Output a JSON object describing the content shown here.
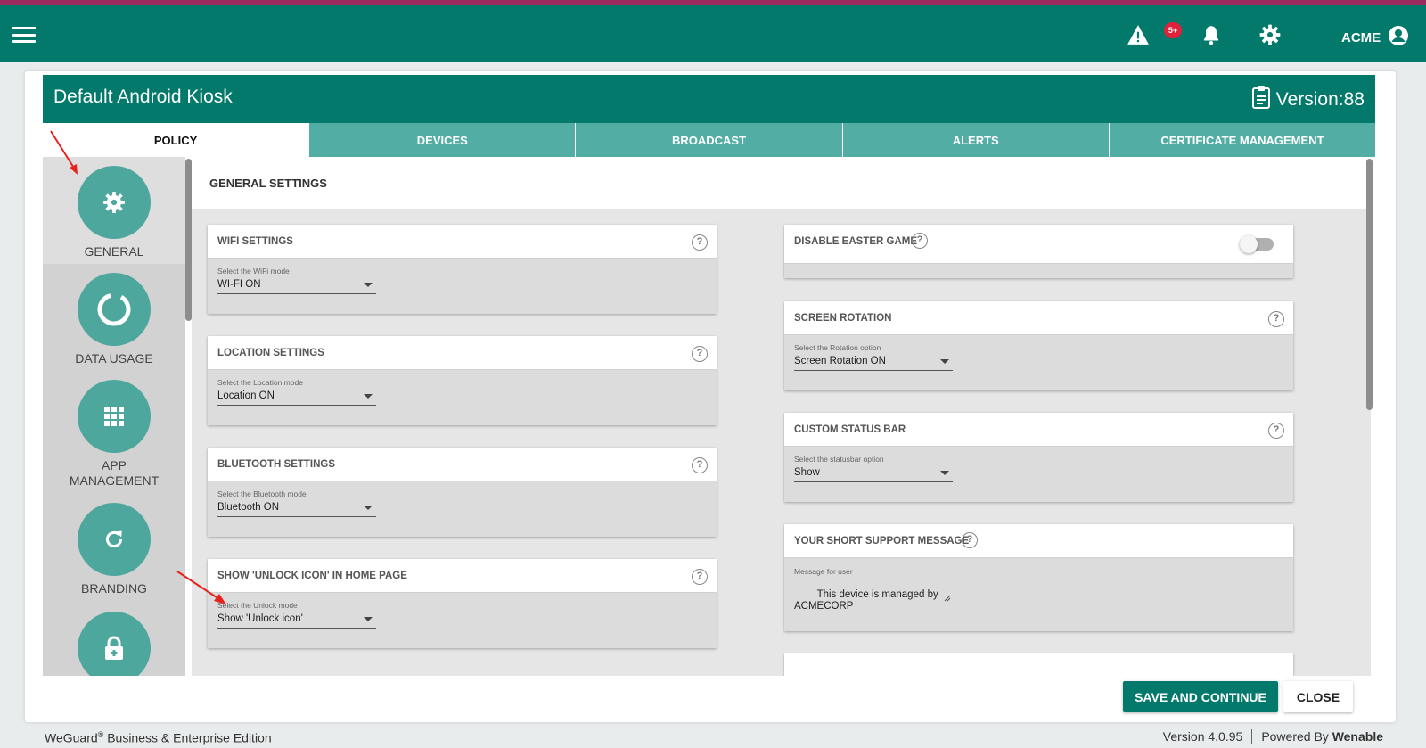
{
  "topbar": {
    "alerts_badge": "5+",
    "user_name": "ACME"
  },
  "policy": {
    "title": "Default Android Kiosk",
    "version": "Version:88"
  },
  "tabs": [
    {
      "label": "POLICY",
      "active": true
    },
    {
      "label": "DEVICES",
      "active": false
    },
    {
      "label": "BROADCAST",
      "active": false
    },
    {
      "label": "ALERTS",
      "active": false
    },
    {
      "label": "CERTIFICATE MANAGEMENT",
      "active": false
    }
  ],
  "nav": [
    {
      "label": "GENERAL",
      "icon": "gear-icon",
      "active": true
    },
    {
      "label": "DATA USAGE",
      "icon": "ring-icon",
      "active": false
    },
    {
      "label": "APP MANAGEMENT",
      "icon": "grid-icon",
      "active": false
    },
    {
      "label": "BRANDING",
      "icon": "refresh-icon",
      "active": false
    },
    {
      "label": "",
      "icon": "lock-icon",
      "active": false
    }
  ],
  "section_title": "GENERAL SETTINGS",
  "left_settings": [
    {
      "title": "WIFI SETTINGS",
      "select_label": "Select the WiFi mode",
      "value": "WI-FI ON"
    },
    {
      "title": "LOCATION SETTINGS",
      "select_label": "Select the Location mode",
      "value": "Location ON"
    },
    {
      "title": "BLUETOOTH SETTINGS",
      "select_label": "Select the Bluetooth mode",
      "value": "Bluetooth ON"
    },
    {
      "title": "SHOW 'UNLOCK ICON' IN HOME PAGE",
      "select_label": "Select the Unlock mode",
      "value": "Show 'Unlock icon'"
    }
  ],
  "right_settings": {
    "easter": {
      "title": "DISABLE EASTER GAME",
      "enabled": false
    },
    "rotation": {
      "title": "SCREEN ROTATION",
      "select_label": "Select the Rotation option",
      "value": "Screen Rotation ON"
    },
    "statusbar": {
      "title": "CUSTOM STATUS BAR",
      "select_label": "Select the statusbar option",
      "value": "Show"
    },
    "support": {
      "title": "YOUR SHORT SUPPORT MESSAGE",
      "field_label": "Message for user",
      "value": "This device is managed by\nACMECORP"
    }
  },
  "buttons": {
    "save": "SAVE AND CONTINUE",
    "close": "CLOSE"
  },
  "footer": {
    "brand": "WeGuard",
    "registered": "®",
    "edition": " Business & Enterprise Edition",
    "version": "Version 4.0.95",
    "powered_prefix": "Powered By ",
    "powered_brand": "Wenable"
  },
  "colors": {
    "primary": "#03796b",
    "tab_inactive": "#52ada4",
    "nav_circle": "#4ea79d",
    "badge": "#e0213a",
    "top_strip": "#9b2a5f"
  }
}
